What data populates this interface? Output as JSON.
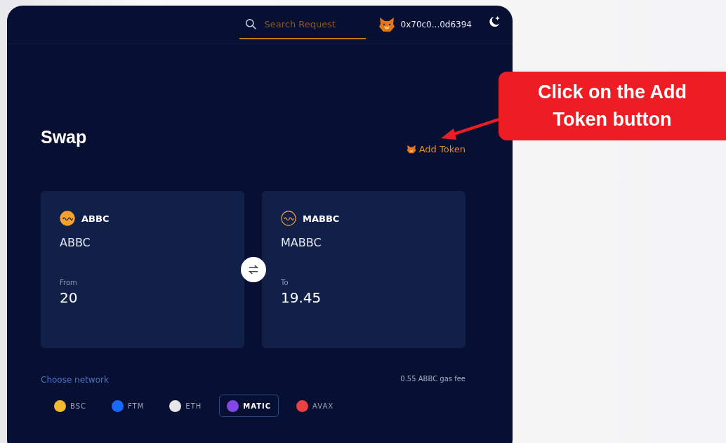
{
  "header": {
    "search": {
      "placeholder": "Search Request"
    },
    "wallet": {
      "address": "0x70c0...0d6394"
    }
  },
  "title": "Swap",
  "add_token": {
    "label": "Add Token"
  },
  "callout": {
    "text": "Click on the Add Token button"
  },
  "cards": [
    {
      "token": "ABBC",
      "name": "ABBC",
      "label": "From",
      "amount": "20",
      "icon_filled": true
    },
    {
      "token": "MABBC",
      "name": "MABBC",
      "label": "To",
      "amount": "19.45",
      "icon_filled": false
    }
  ],
  "network_label": "Choose network",
  "gas_fee": "0.55 ABBC gas fee",
  "networks": [
    {
      "label": "BSC",
      "selected": false,
      "color": "#f3ba2f"
    },
    {
      "label": "FTM",
      "selected": false,
      "color": "#1969ff"
    },
    {
      "label": "ETH",
      "selected": false,
      "color": "#e6e6e6"
    },
    {
      "label": "MATIC",
      "selected": true,
      "color": "#8247e5"
    },
    {
      "label": "AVAX",
      "selected": false,
      "color": "#e84142"
    }
  ]
}
